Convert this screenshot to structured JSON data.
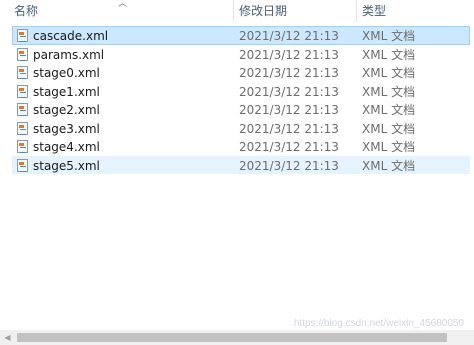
{
  "columns": {
    "name": "名称",
    "date": "修改日期",
    "type": "类型"
  },
  "files": [
    {
      "name": "cascade.xml",
      "date": "2021/3/12 21:13",
      "type": "XML 文档"
    },
    {
      "name": "params.xml",
      "date": "2021/3/12 21:13",
      "type": "XML 文档"
    },
    {
      "name": "stage0.xml",
      "date": "2021/3/12 21:13",
      "type": "XML 文档"
    },
    {
      "name": "stage1.xml",
      "date": "2021/3/12 21:13",
      "type": "XML 文档"
    },
    {
      "name": "stage2.xml",
      "date": "2021/3/12 21:13",
      "type": "XML 文档"
    },
    {
      "name": "stage3.xml",
      "date": "2021/3/12 21:13",
      "type": "XML 文档"
    },
    {
      "name": "stage4.xml",
      "date": "2021/3/12 21:13",
      "type": "XML 文档"
    },
    {
      "name": "stage5.xml",
      "date": "2021/3/12 21:13",
      "type": "XML 文档"
    }
  ],
  "watermark": "https://blog.csdn.net/weixin_45680050",
  "icons": {
    "file": "xml-file-icon",
    "sort": "sort-up-icon"
  },
  "colors": {
    "selected_bg": "#cce8ff",
    "hover_bg": "#e5f3ff",
    "header_text": "#4c607a"
  }
}
